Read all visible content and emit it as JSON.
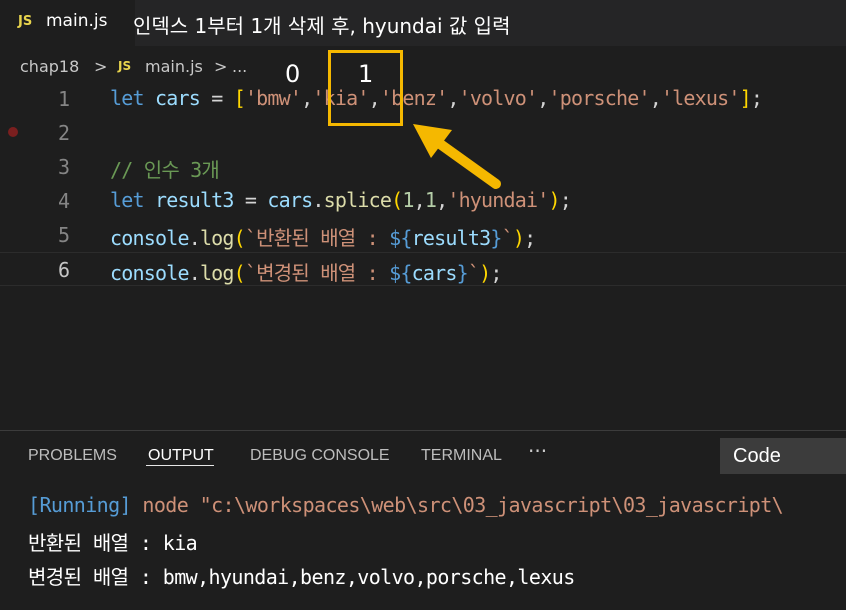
{
  "tab": {
    "badge": "JS",
    "filename": "main.js"
  },
  "caption": "인덱스 1부터 1개 삭제 후, hyundai 값 입력",
  "breadcrumb": {
    "folder": "chap18",
    "sep": ">",
    "badge": "JS",
    "file": "main.js",
    "sep2": ">",
    "ellipsis": "..."
  },
  "annotations": {
    "index0": "0",
    "index1": "1",
    "highlight_color": "#f5b800"
  },
  "editor": {
    "line_numbers": [
      "1",
      "2",
      "3",
      "4",
      "5",
      "6"
    ],
    "line1": {
      "kw": "let",
      "name": " cars",
      "op": " = ",
      "open": "[",
      "items": [
        "'bmw'",
        "'kia'",
        "'benz'",
        "'volvo'",
        "'porsche'",
        "'lexus'"
      ],
      "close": "]",
      "end": ";"
    },
    "line3": "// 인수 3개",
    "line4": {
      "kw": "let",
      "name": " result3",
      "op": " = ",
      "obj": "cars",
      "method": "splice",
      "a1": "1",
      "a2": "1",
      "a3": "'hyundai'",
      "end": ";"
    },
    "line5": {
      "obj": "console",
      "method": "log",
      "text": "`반환된 배열 : ",
      "ph_open": "${",
      "var": "result3",
      "ph_close": "}",
      "tail": "`",
      "end": ";"
    },
    "line6": {
      "obj": "console",
      "method": "log",
      "text": "`변경된 배열 : ",
      "ph_open": "${",
      "var": "cars",
      "ph_close": "}",
      "tail": "`",
      "end": ";"
    }
  },
  "panel": {
    "tabs": [
      "PROBLEMS",
      "OUTPUT",
      "DEBUG CONSOLE",
      "TERMINAL"
    ],
    "more": "···",
    "select": "Code",
    "output": {
      "running": "[Running]",
      "command": " node \"c:\\workspaces\\web\\src\\03_javascript\\03_javascript\\",
      "line2": "반환된 배열 : kia",
      "line3": "변경된 배열 : bmw,hyundai,benz,volvo,porsche,lexus"
    }
  }
}
